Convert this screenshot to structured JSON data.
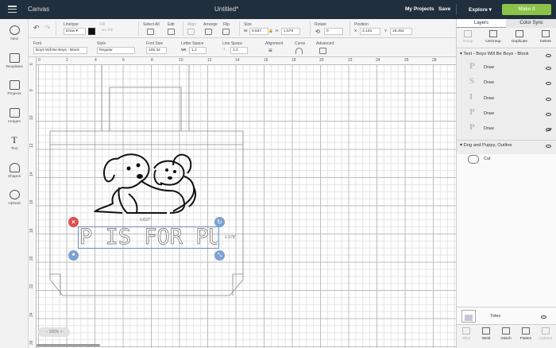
{
  "header": {
    "app_title": "Canvas",
    "document_title": "Untitled*",
    "my_projects": "My Projects",
    "save": "Save",
    "explore": "Explore",
    "make_it": "Make It"
  },
  "toolbar": {
    "undo_icon": "undo-icon",
    "redo_icon": "redo-icon",
    "linetype_label": "Linetype",
    "linetype_value": "Draw",
    "fill_label": "Fill",
    "fill_value": "No Fill",
    "select_all_label": "Select All",
    "edit_label": "Edit",
    "align_label": "Align",
    "arrange_label": "Arrange",
    "flip_label": "Flip",
    "size_label": "Size",
    "w_label": "W",
    "w_value": "9.637",
    "h_label": "H",
    "h_value": "1.578",
    "rotate_label": "Rotate",
    "rotate_value": "0",
    "position_label": "Position",
    "x_label": "X",
    "x_value": "3.133",
    "y_label": "Y",
    "y_value": "18.452"
  },
  "text_toolbar": {
    "font_label": "Font",
    "font_value": "Boys Will Be Boys - Block",
    "style_label": "Style",
    "style_value": "Regular",
    "font_size_label": "Font Size",
    "font_size_value": "105.32",
    "letter_space_label": "Letter Space",
    "letter_space_prefix": "VA",
    "letter_space_value": "1.2",
    "line_space_label": "Line Space",
    "line_space_value": "1.2",
    "alignment_label": "Alignment",
    "curve_label": "Curve",
    "advanced_label": "Advanced"
  },
  "leftnav": [
    {
      "label": "New"
    },
    {
      "label": "Templates"
    },
    {
      "label": "Projects"
    },
    {
      "label": "Images"
    },
    {
      "label": "Text"
    },
    {
      "label": "Shapes"
    },
    {
      "label": "Upload"
    }
  ],
  "ruler": {
    "top": [
      "0",
      "2",
      "4",
      "6",
      "8",
      "10",
      "12",
      "14",
      "16",
      "18",
      "20",
      "22",
      "24",
      "26",
      "28"
    ],
    "left": [
      "6",
      "8",
      "10",
      "12",
      "14",
      "16",
      "18",
      "20",
      "22",
      "24",
      "26"
    ]
  },
  "canvas": {
    "text_art": "P IS FOR PUPPY",
    "width_readout": "9.637\"",
    "height_readout": "1.578\"",
    "zoom": "100%"
  },
  "rightpanel": {
    "tabs": [
      "Layers",
      "Color Sync"
    ],
    "tools": [
      "Group",
      "UnGroup",
      "Duplicate",
      "Delete"
    ],
    "layer_groups": [
      {
        "name": "Text - Boys Will Be Boys - Block",
        "children": [
          {
            "glyph": "P",
            "label": "Draw"
          },
          {
            "glyph": "S",
            "label": "Draw"
          },
          {
            "glyph": "I",
            "label": "Draw"
          },
          {
            "glyph": "P",
            "label": "Draw"
          },
          {
            "glyph": "P",
            "label": "Draw"
          }
        ]
      },
      {
        "name": "Dog and Puppy, Outline",
        "children": [
          {
            "label": "Cut"
          }
        ]
      }
    ],
    "canvas_layer_label": "Totes",
    "bottom_tools": [
      "Slice",
      "Weld",
      "Attach",
      "Flatten",
      "Contour"
    ]
  }
}
